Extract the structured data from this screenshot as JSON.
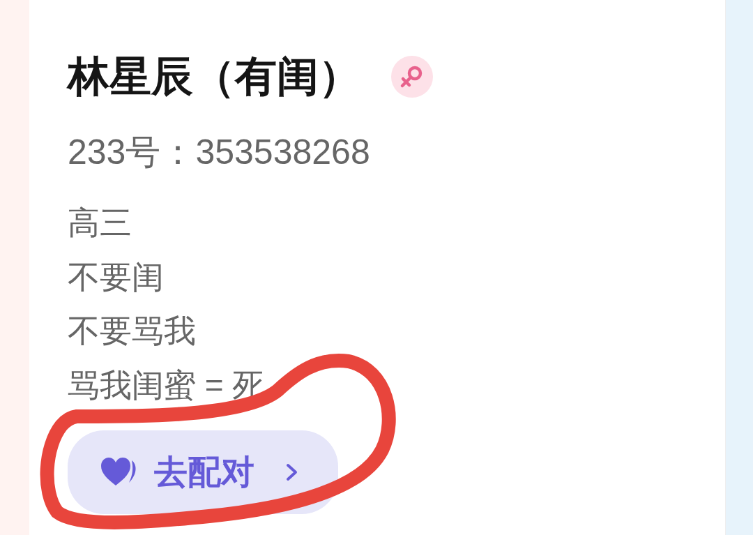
{
  "profile": {
    "name": "林星辰（有闺）",
    "gender_badge": {
      "kind": "female"
    },
    "id_line": "233号：353538268",
    "bio": [
      "高三",
      "不要闺",
      "不要骂我",
      "骂我闺蜜 = 死"
    ]
  },
  "match_button": {
    "label": "去配对"
  },
  "annotation": {
    "kind": "circle"
  }
}
